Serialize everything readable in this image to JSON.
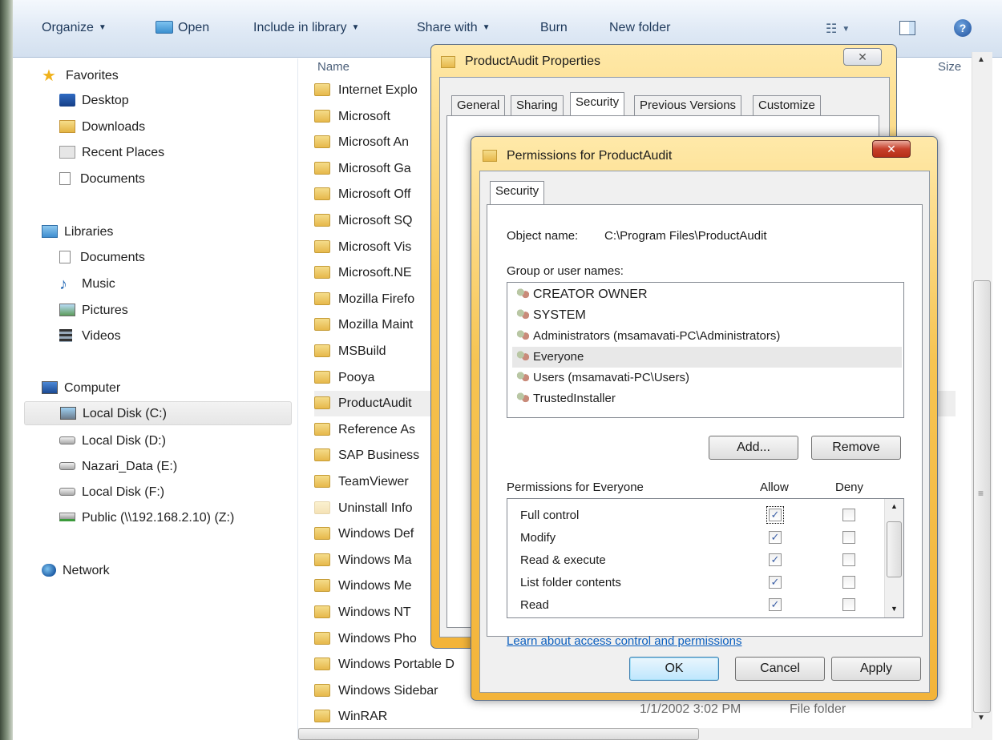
{
  "toolbar": {
    "organize": "Organize",
    "open": "Open",
    "include_in_library": "Include in library",
    "share_with": "Share with",
    "burn": "Burn",
    "new_folder": "New folder"
  },
  "nav": {
    "favorites": "Favorites",
    "desktop": "Desktop",
    "downloads": "Downloads",
    "recent_places": "Recent Places",
    "documents_fav": "Documents",
    "libraries": "Libraries",
    "documents": "Documents",
    "music": "Music",
    "pictures": "Pictures",
    "videos": "Videos",
    "computer": "Computer",
    "local_c": "Local Disk (C:)",
    "local_d": "Local Disk (D:)",
    "nazari_e": "Nazari_Data (E:)",
    "local_f": "Local Disk (F:)",
    "public_z": "Public (\\\\192.168.2.10) (Z:)",
    "network": "Network"
  },
  "filelist": {
    "col_name": "Name",
    "col_size": "Size",
    "rows": [
      "Internet Explo",
      "Microsoft",
      "Microsoft An",
      "Microsoft Ga",
      "Microsoft Off",
      "Microsoft SQ",
      "Microsoft Vis",
      "Microsoft.NE",
      "Mozilla Firefo",
      "Mozilla Maint",
      "MSBuild",
      "Pooya",
      "ProductAudit",
      "Reference As",
      "SAP Business",
      "TeamViewer",
      "Uninstall Info",
      "Windows Def",
      "Windows Ma",
      "Windows Me",
      "Windows NT",
      "Windows Pho",
      "Windows Portable D",
      "Windows Sidebar",
      "WinRAR"
    ],
    "winrar_date": "1/1/2002 3:02 PM",
    "winrar_type": "File folder"
  },
  "props": {
    "title": "ProductAudit Properties",
    "tabs": [
      "General",
      "Sharing",
      "Security",
      "Previous Versions",
      "Customize"
    ]
  },
  "perm": {
    "title": "Permissions for ProductAudit",
    "tab": "Security",
    "object_label": "Object name:",
    "object_value": "C:\\Program Files\\ProductAudit",
    "group_label": "Group or user names:",
    "users": [
      "CREATOR OWNER",
      "SYSTEM",
      "Administrators (msamavati-PC\\Administrators)",
      "Everyone",
      "Users (msamavati-PC\\Users)",
      "TrustedInstaller"
    ],
    "add": "Add...",
    "remove": "Remove",
    "perm_for": "Permissions for Everyone",
    "allow": "Allow",
    "deny": "Deny",
    "permissions": [
      {
        "name": "Full control",
        "allow": true,
        "deny": false
      },
      {
        "name": "Modify",
        "allow": true,
        "deny": false
      },
      {
        "name": "Read & execute",
        "allow": true,
        "deny": false
      },
      {
        "name": "List folder contents",
        "allow": true,
        "deny": false
      },
      {
        "name": "Read",
        "allow": true,
        "deny": false
      }
    ],
    "learn_link": "Learn about access control and permissions",
    "ok": "OK",
    "cancel": "Cancel",
    "apply": "Apply"
  }
}
